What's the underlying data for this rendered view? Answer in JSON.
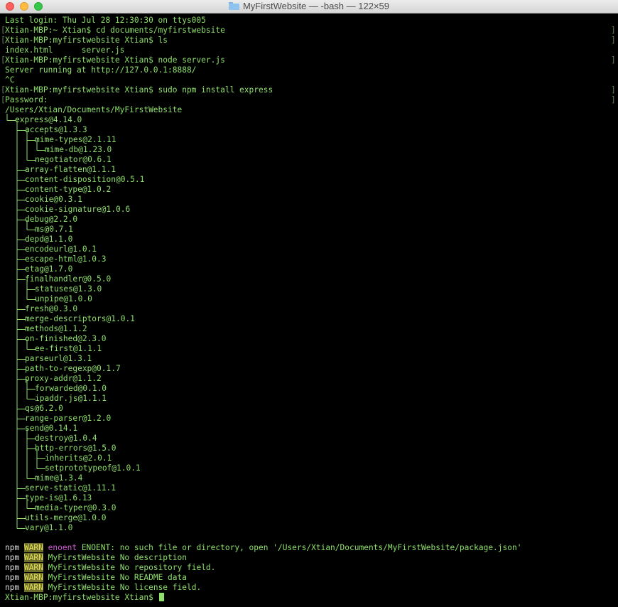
{
  "window": {
    "title": "MyFirstWebsite — -bash — 122×59"
  },
  "terminal": {
    "lines": [
      "Last login: Thu Jul 28 12:30:30 on ttys005",
      "Xtian-MBP:~ Xtian$ cd documents/myfirstwebsite",
      "Xtian-MBP:myfirstwebsite Xtian$ ls",
      "index.html      server.js",
      "Xtian-MBP:myfirstwebsite Xtian$ node server.js",
      "Server running at http://127.0.0.1:8888/",
      "^C",
      "Xtian-MBP:myfirstwebsite Xtian$ sudo npm install express",
      "Password:",
      "/Users/Xtian/Documents/MyFirstWebsite"
    ],
    "bracketed_rows": [
      1,
      2,
      4,
      7,
      8
    ],
    "tree": [
      {
        "depth": 0,
        "label": "express@4.14.0"
      },
      {
        "depth": 1,
        "label": "accepts@1.3.3"
      },
      {
        "depth": 2,
        "label": "mime-types@2.1.11"
      },
      {
        "depth": 3,
        "label": "mime-db@1.23.0"
      },
      {
        "depth": 2,
        "label": "negotiator@0.6.1"
      },
      {
        "depth": 1,
        "label": "array-flatten@1.1.1"
      },
      {
        "depth": 1,
        "label": "content-disposition@0.5.1"
      },
      {
        "depth": 1,
        "label": "content-type@1.0.2"
      },
      {
        "depth": 1,
        "label": "cookie@0.3.1"
      },
      {
        "depth": 1,
        "label": "cookie-signature@1.0.6"
      },
      {
        "depth": 1,
        "label": "debug@2.2.0"
      },
      {
        "depth": 2,
        "label": "ms@0.7.1"
      },
      {
        "depth": 1,
        "label": "depd@1.1.0"
      },
      {
        "depth": 1,
        "label": "encodeurl@1.0.1"
      },
      {
        "depth": 1,
        "label": "escape-html@1.0.3"
      },
      {
        "depth": 1,
        "label": "etag@1.7.0"
      },
      {
        "depth": 1,
        "label": "finalhandler@0.5.0"
      },
      {
        "depth": 2,
        "label": "statuses@1.3.0"
      },
      {
        "depth": 2,
        "label": "unpipe@1.0.0"
      },
      {
        "depth": 1,
        "label": "fresh@0.3.0"
      },
      {
        "depth": 1,
        "label": "merge-descriptors@1.0.1"
      },
      {
        "depth": 1,
        "label": "methods@1.1.2"
      },
      {
        "depth": 1,
        "label": "on-finished@2.3.0"
      },
      {
        "depth": 2,
        "label": "ee-first@1.1.1"
      },
      {
        "depth": 1,
        "label": "parseurl@1.3.1"
      },
      {
        "depth": 1,
        "label": "path-to-regexp@0.1.7"
      },
      {
        "depth": 1,
        "label": "proxy-addr@1.1.2"
      },
      {
        "depth": 2,
        "label": "forwarded@0.1.0"
      },
      {
        "depth": 2,
        "label": "ipaddr.js@1.1.1"
      },
      {
        "depth": 1,
        "label": "qs@6.2.0"
      },
      {
        "depth": 1,
        "label": "range-parser@1.2.0"
      },
      {
        "depth": 1,
        "label": "send@0.14.1"
      },
      {
        "depth": 2,
        "label": "destroy@1.0.4"
      },
      {
        "depth": 2,
        "label": "http-errors@1.5.0"
      },
      {
        "depth": 3,
        "label": "inherits@2.0.1"
      },
      {
        "depth": 3,
        "label": "setprototypeof@1.0.1"
      },
      {
        "depth": 2,
        "label": "mime@1.3.4"
      },
      {
        "depth": 1,
        "label": "serve-static@1.11.1"
      },
      {
        "depth": 1,
        "label": "type-is@1.6.13"
      },
      {
        "depth": 2,
        "label": "media-typer@0.3.0"
      },
      {
        "depth": 1,
        "label": "utils-merge@1.0.0"
      },
      {
        "depth": 1,
        "label": "vary@1.1.0"
      }
    ],
    "warnings": [
      {
        "prefix": "npm",
        "level": "WARN",
        "code": "enoent",
        "message": " ENOENT: no such file or directory, open '/Users/Xtian/Documents/MyFirstWebsite/package.json'"
      },
      {
        "prefix": "npm",
        "level": "WARN",
        "code": "",
        "message": "MyFirstWebsite No description"
      },
      {
        "prefix": "npm",
        "level": "WARN",
        "code": "",
        "message": "MyFirstWebsite No repository field."
      },
      {
        "prefix": "npm",
        "level": "WARN",
        "code": "",
        "message": "MyFirstWebsite No README data"
      },
      {
        "prefix": "npm",
        "level": "WARN",
        "code": "",
        "message": "MyFirstWebsite No license field."
      }
    ],
    "final_prompt": "Xtian-MBP:myfirstwebsite Xtian$ "
  },
  "colors": {
    "text": "#8ee06b",
    "tree_lines": "#8ee06b",
    "warn_bg": "#6d6d2c",
    "warn_fg": "#e7e25a",
    "enoent": "#d35ad8",
    "npm": "#dedede"
  }
}
